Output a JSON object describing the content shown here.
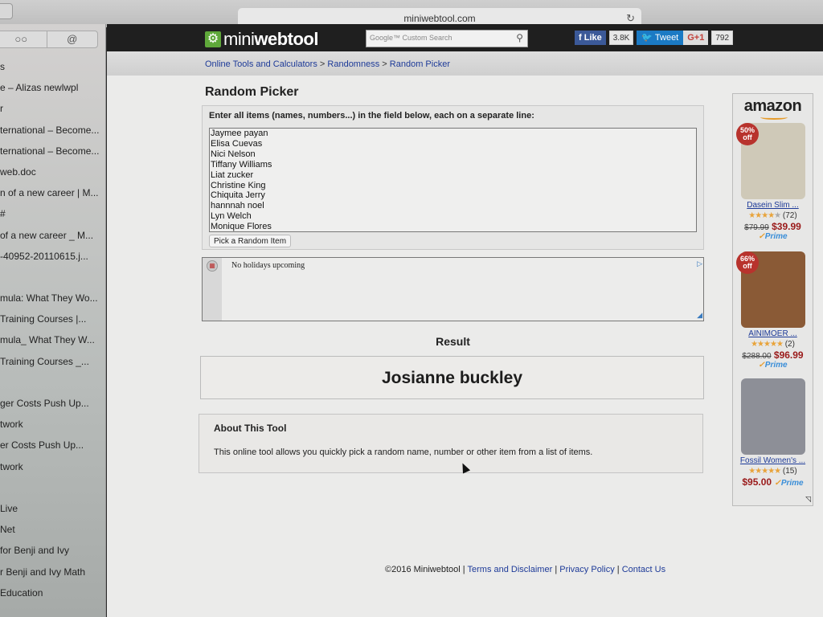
{
  "browser": {
    "url": "miniwebtool.com",
    "sidebar_tabs": [
      "reading-list-icon",
      "shared-links-icon"
    ],
    "sidebar_tab_glyphs": [
      "○○",
      "@"
    ],
    "sidebar_items": [
      "s",
      "e – Alizas newlwpl",
      "r",
      "ternational – Become...",
      "ternational – Become...",
      " web.doc",
      "n of a new career | M...",
      "#",
      " of a new career _ M...",
      "-40952-20110615.j...",
      "",
      "mula: What They Wo...",
      " Training Courses |...",
      "mula_ What They W...",
      " Training Courses _...",
      "",
      "ger Costs Push Up...",
      "twork",
      "er Costs Push Up...",
      "twork",
      "",
      "Live",
      "Net",
      " for Benji and Ivy",
      "r Benji and Ivy Math",
      "Education"
    ]
  },
  "header": {
    "logo_light": "mini",
    "logo_bold": "webtool",
    "search_placeholder": "Google™ Custom Search",
    "fb_like_label": "Like",
    "fb_count": "3.8K",
    "tweet_label": "Tweet",
    "gplus_label": "G+1",
    "gplus_count": "792"
  },
  "breadcrumb": {
    "items": [
      "Online Tools and Calculators",
      "Randomness",
      "Random Picker"
    ],
    "separator": ">"
  },
  "tool": {
    "title": "Random Picker",
    "input_label": "Enter all items (names, numbers...) in the field below, each on a separate line:",
    "items": "Jaymee payan\nElisa Cuevas\nNici Nelson\nTiffany Williams\nLiat zucker\nChristine King\nChiquita Jerry\nhannnah noel\nLyn Welch\nMonique Flores",
    "pick_button_label": "Pick a Random Item"
  },
  "ad_banner": {
    "text": "No holidays upcoming"
  },
  "result": {
    "title": "Result",
    "value": "Josianne buckley"
  },
  "about": {
    "title": "About This Tool",
    "text": "This online tool allows you quickly pick a random name, number or other item from a list of items."
  },
  "amazon": {
    "logo": "amazon",
    "products": [
      {
        "badge": "50% off",
        "name": "Dasein Slim ...",
        "rating": 4,
        "reviews": "(72)",
        "old_price": "$79.99",
        "price": "$39.99",
        "prime": "Prime",
        "image_color": "#cfc9b8"
      },
      {
        "badge": "66% off",
        "name": "AINIMOER ...",
        "rating": 4.5,
        "reviews": "(2)",
        "old_price": "$288.00",
        "price": "$96.99",
        "prime": "Prime",
        "image_color": "#8a5a36"
      },
      {
        "badge": "",
        "name": "Fossil Women's ...",
        "rating": 4.5,
        "reviews": "(15)",
        "old_price": "",
        "price": "$95.00",
        "prime": "Prime",
        "image_color": "#8d8f97"
      }
    ]
  },
  "footer": {
    "copyright": "©2016 Miniwebtool",
    "links": [
      "Terms and Disclaimer",
      "Privacy Policy",
      "Contact Us"
    ],
    "separator": "|"
  }
}
